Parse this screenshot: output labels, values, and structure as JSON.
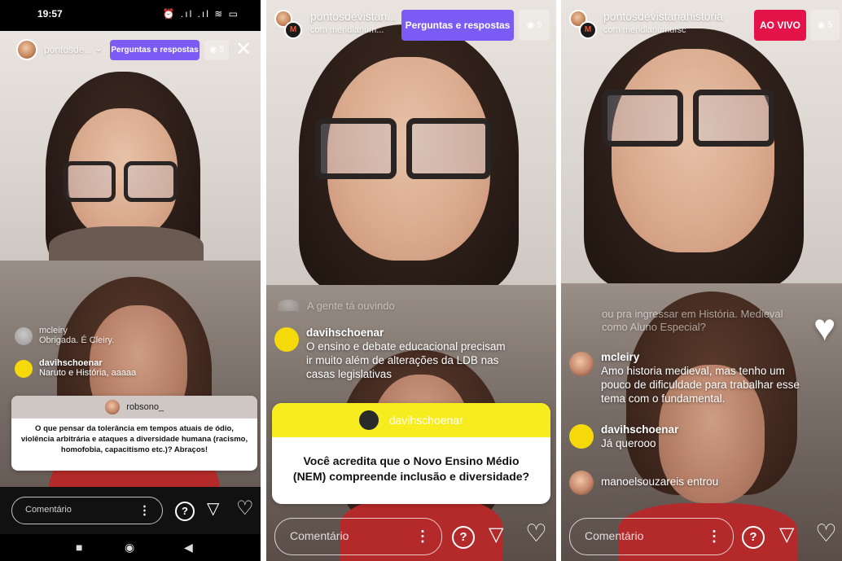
{
  "panel1": {
    "status_time": "19:57",
    "status_icons": "⏰ .ıl .ıl ≋ ▭",
    "account": "pontosde...",
    "qa_button": "Perguntas e respostas",
    "viewer_count": "5",
    "close_glyph": "✕",
    "comments": [
      {
        "user": "mcleiry",
        "text": "Obrigada. É Cleiry."
      },
      {
        "user": "davihschoenar",
        "text": "Naruto e História, aaaaa"
      }
    ],
    "question": {
      "user": "robsono_",
      "text": "O que pensar da tolerância em tempos atuais de ódio, violência arbitrária e ataques a diversidade humana (racismo, homofobia, capacitismo etc.)? Abraços!"
    },
    "comment_placeholder": "Comentário",
    "nav": [
      "■",
      "◉",
      "◀"
    ]
  },
  "panel2": {
    "account": "pontosdevistan...",
    "subtitle": "com meridianum...",
    "qa_button": "Perguntas e respostas",
    "viewer_count": "5",
    "faded_comment": "A gente tá ouvindo",
    "comments": [
      {
        "user": "davihschoenar",
        "text": "O ensino e debate educacional precisam ir muito além de alterações da LDB nas casas legislativas"
      }
    ],
    "question": {
      "user": "davihschoenar",
      "text": "Você acredita que o Novo Ensino Médio (NEM) compreende inclusão e diversidade?"
    },
    "comment_placeholder": "Comentário"
  },
  "panel3": {
    "account": "pontosdevistanahistoria",
    "subtitle": "com meridianumufsc",
    "live_badge": "AO VIVO",
    "viewer_count": "5",
    "faded_comment": "ou pra ingressar em História. Medieval como Aluno Especial?",
    "comments": [
      {
        "user": "mcleiry",
        "text": "Amo historia medieval, mas tenho um pouco de dificuldade para trabalhar esse tema com o fundamental."
      },
      {
        "user": "davihschoenar",
        "text": "Já querooo"
      },
      {
        "user": "",
        "text": "manoelsouzareis entrou"
      }
    ],
    "comment_placeholder": "Comentário"
  },
  "icons": {
    "kebab": "⋮",
    "question": "?",
    "send": "▽",
    "heart": "♡",
    "heart_filled": "♥",
    "eye": "👁"
  },
  "colors": {
    "qa_purple": "#7a5cf5",
    "live_red": "#e4144a",
    "question_yellow": "#f7ec1e",
    "avatar_yellow": "#f5d90a"
  }
}
